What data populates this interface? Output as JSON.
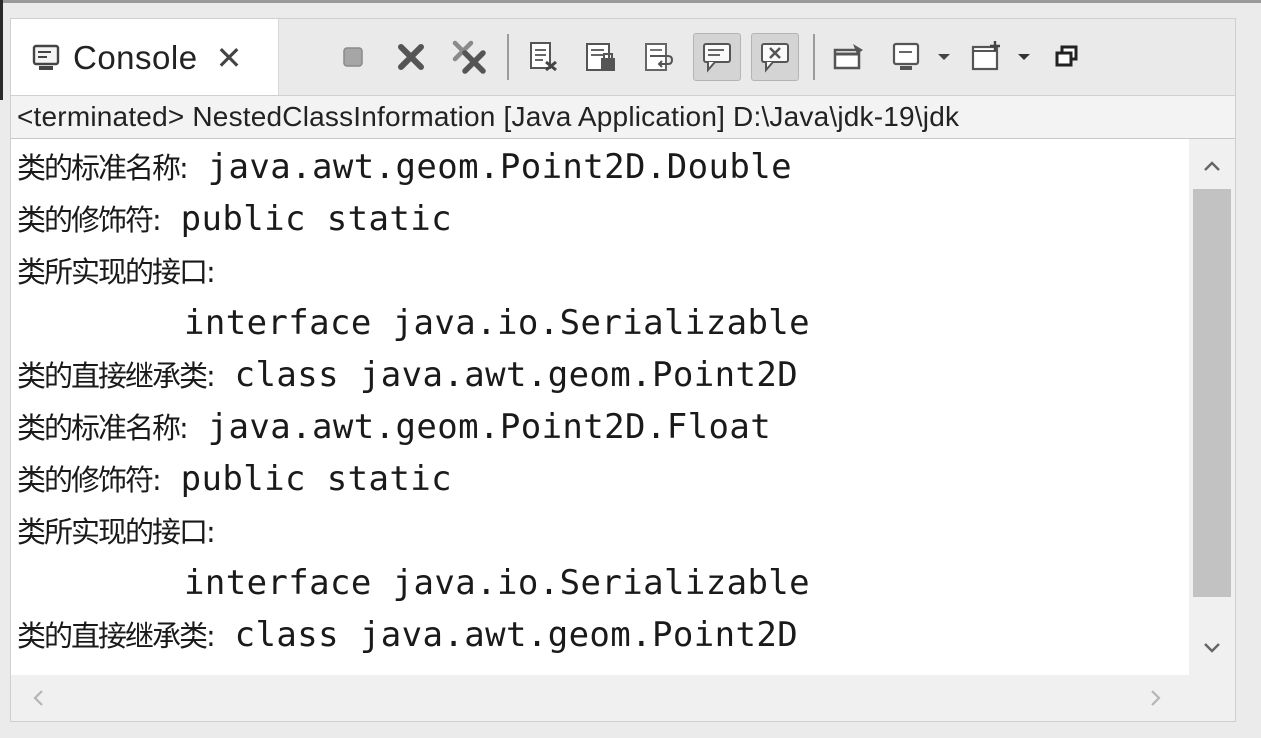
{
  "tab": {
    "icon": "console-icon",
    "label": "Console",
    "close_glyph": "✕"
  },
  "toolbar": {
    "buttons": [
      {
        "name": "terminate-icon"
      },
      {
        "name": "remove-launch-icon"
      },
      {
        "name": "remove-all-terminated-icon"
      },
      {
        "name": "clear-console-icon"
      },
      {
        "name": "scroll-lock-icon"
      },
      {
        "name": "word-wrap-icon"
      },
      {
        "name": "show-console-on-stdout-icon",
        "pressed": true
      },
      {
        "name": "show-console-on-stderr-icon",
        "pressed": true
      },
      {
        "name": "pin-console-icon"
      },
      {
        "name": "display-selected-console-icon",
        "dropdown": true
      },
      {
        "name": "open-console-icon",
        "dropdown": true
      },
      {
        "name": "restore-view-icon"
      }
    ]
  },
  "description": "<terminated> NestedClassInformation [Java Application] D:\\Java\\jdk-19\\jdk",
  "console": {
    "lines": [
      {
        "label": "类的标准名称:",
        "code": " java.awt.geom.Point2D.Double"
      },
      {
        "label": "类的修饰符:",
        "code": " public static"
      },
      {
        "label": "类所实现的接口:",
        "code": ""
      },
      {
        "label": "",
        "code": "        interface java.io.Serializable"
      },
      {
        "label": "类的直接继承类:",
        "code": " class java.awt.geom.Point2D"
      },
      {
        "label": "类的标准名称:",
        "code": " java.awt.geom.Point2D.Float"
      },
      {
        "label": "类的修饰符:",
        "code": " public static"
      },
      {
        "label": "类所实现的接口:",
        "code": ""
      },
      {
        "label": "",
        "code": "        interface java.io.Serializable"
      },
      {
        "label": "类的直接继承类:",
        "code": " class java.awt.geom.Point2D"
      }
    ]
  },
  "scrollbars": {
    "up_icon": "chevron-up-icon",
    "down_icon": "chevron-down-icon",
    "left_icon": "chevron-left-icon",
    "right_icon": "chevron-right-icon"
  }
}
